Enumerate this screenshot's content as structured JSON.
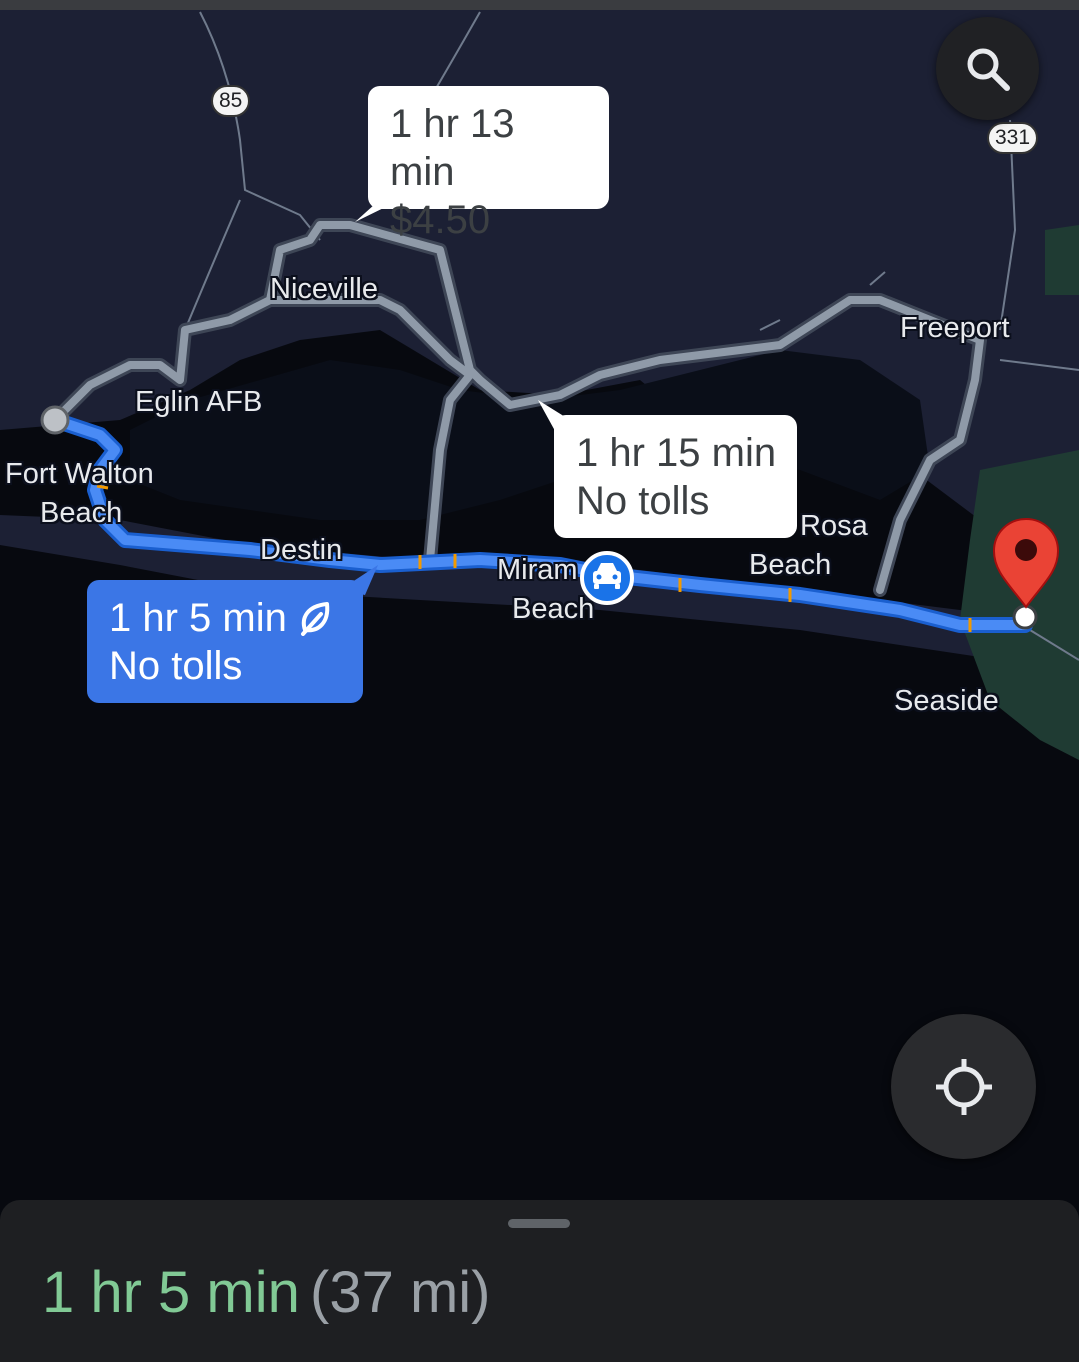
{
  "search": {
    "icon": "search-icon"
  },
  "shields": {
    "hwy_85": "85",
    "hwy_331": "331"
  },
  "places": {
    "niceville": "Niceville",
    "eglin": "Eglin AFB",
    "fort_walton_1": "Fort Walton",
    "fort_walton_2": "Beach",
    "destin": "Destin",
    "miramar_1": "Miram",
    "miramar_2": "Beach",
    "rosa_1": "Rosa",
    "rosa_2": "Beach",
    "freeport": "Freeport",
    "seaside": "Seaside"
  },
  "routes": {
    "alt_north": {
      "time": "1 hr 13 min",
      "detail": "$4.50"
    },
    "alt_inland": {
      "time": "1 hr 15 min",
      "detail": "No tolls"
    },
    "primary": {
      "time": "1 hr 5 min",
      "detail": "No tolls",
      "icon": "leaf-icon"
    }
  },
  "colors": {
    "route_primary": "#4a8bf5",
    "route_alt": "#8f9aa8",
    "destination_pin": "#ea4335",
    "eta_green": "#81c995"
  },
  "bottom_sheet": {
    "eta": "1 hr 5 min",
    "distance": "(37 mi)"
  }
}
